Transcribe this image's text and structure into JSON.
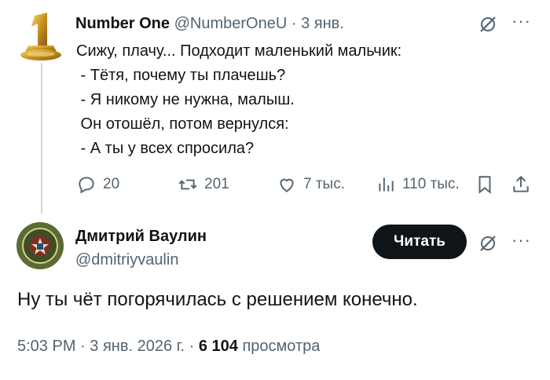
{
  "parent": {
    "name": "Number One",
    "handle": "@NumberOneU",
    "date": "3 янв.",
    "text": "Сижу, плачу... Подходит маленький мальчик:\n - Тётя, почему ты плачешь?\n - Я никому не нужна, малыш.\n Он отошёл, потом вернулся:\n - А ты у всех спросила?",
    "stats": {
      "replies": "20",
      "reposts": "201",
      "likes": "7 тыс.",
      "views": "110 тыс."
    }
  },
  "reply": {
    "name": "Дмитрий Ваулин",
    "handle": "@dmitriyvaulin",
    "follow_label": "Читать",
    "text": "Ну ты чёт погорячилась с решением конечно.",
    "time": "5:03 PM",
    "date": "3 янв. 2026 г.",
    "views_count": "6 104",
    "views_label": "просмотра"
  },
  "icons": [
    "grok-icon",
    "more-icon",
    "reply-icon",
    "repost-icon",
    "like-icon",
    "views-icon",
    "bookmark-icon",
    "share-icon"
  ],
  "colors": {
    "muted": "#536471",
    "text": "#0f1419",
    "button": "#0f1419",
    "gold": "#d4a53a"
  }
}
